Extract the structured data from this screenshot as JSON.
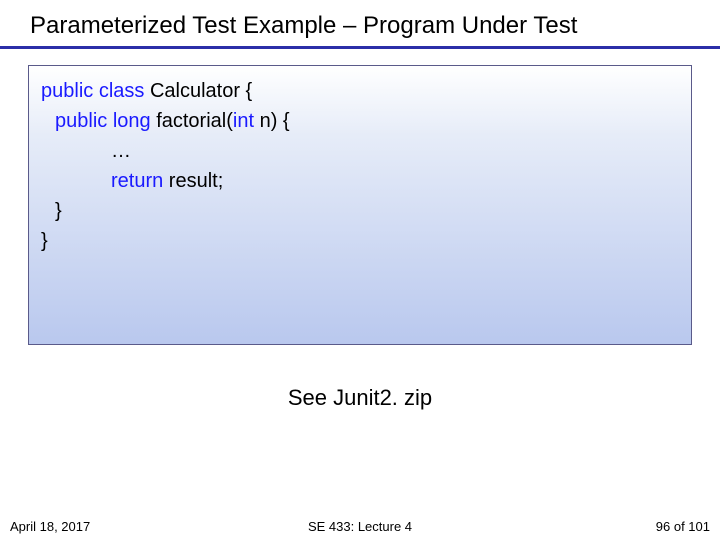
{
  "title": "Parameterized Test Example – Program Under Test",
  "code": {
    "l1a": "public",
    "l1b": " class",
    "l1c": " Calculator {",
    "l2a": "public",
    "l2b": " long",
    "l2c": " factorial(",
    "l2d": "int",
    "l2e": " n) {",
    "l3": "…",
    "l4a": "return",
    "l4b": " result;",
    "l5": "}",
    "l6": "}"
  },
  "note": "See Junit2. zip",
  "footer": {
    "date": "April 18, 2017",
    "course": "SE 433: Lecture 4",
    "page": "96 of 101"
  }
}
